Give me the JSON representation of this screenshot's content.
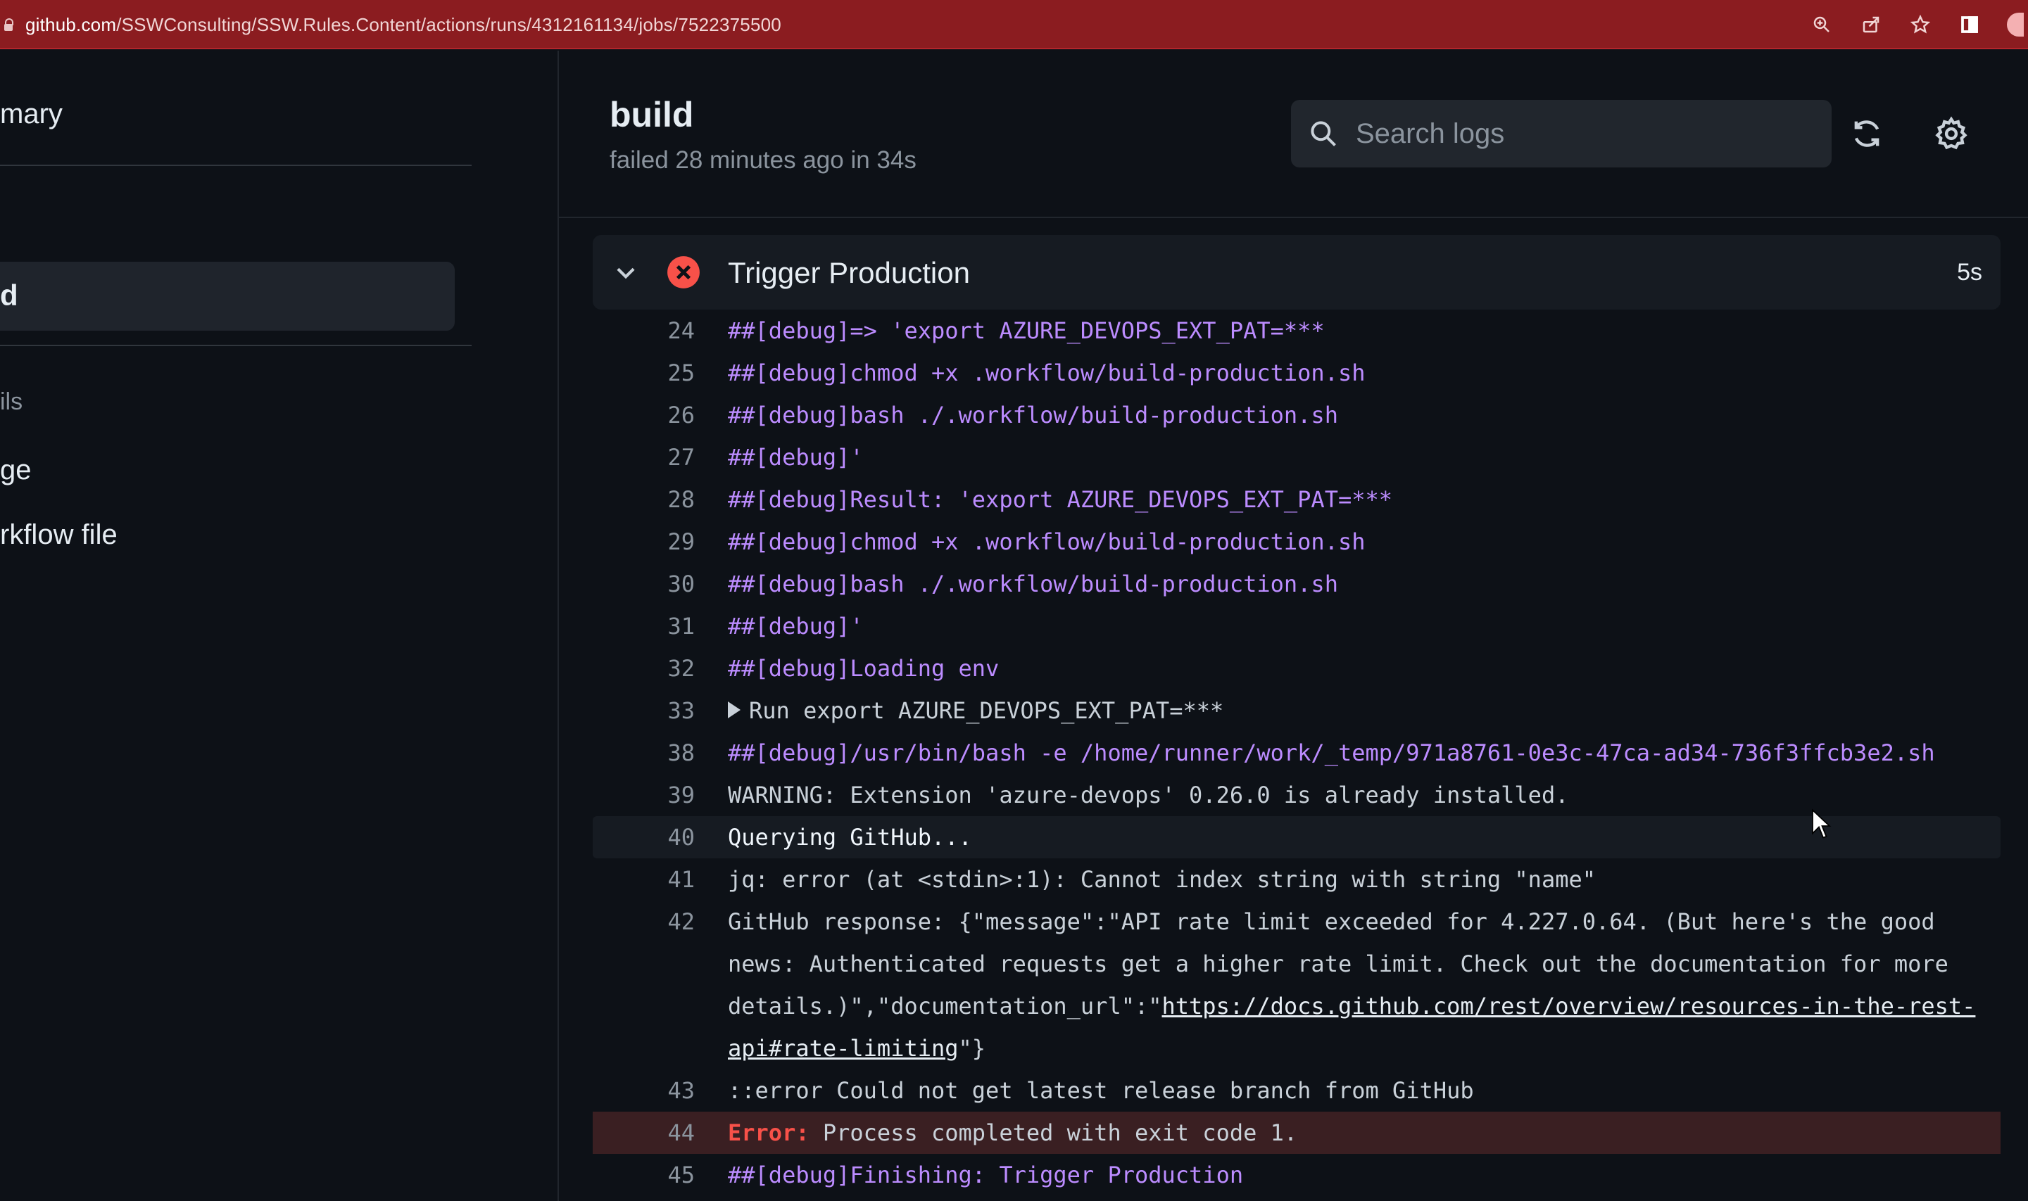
{
  "browser": {
    "url_host": "github.com",
    "url_path": "/SSWConsulting/SSW.Rules.Content/actions/runs/4312161134/jobs/7522375500"
  },
  "sidebar": {
    "summary": "mary",
    "build": "d",
    "details": "ils",
    "usage": "ge",
    "workflow_file": "rkflow file"
  },
  "job": {
    "title": "build",
    "status": "failed 28 minutes ago in 34s"
  },
  "search": {
    "placeholder": "Search logs"
  },
  "step": {
    "name": "Trigger Production",
    "duration": "5s"
  },
  "log": {
    "lines": [
      {
        "n": "24",
        "text": "##[debug]=> 'export AZURE_DEVOPS_EXT_PAT=***"
      },
      {
        "n": "25",
        "text": "##[debug]chmod +x .workflow/build-production.sh"
      },
      {
        "n": "26",
        "text": "##[debug]bash ./.workflow/build-production.sh"
      },
      {
        "n": "27",
        "text": "##[debug]'"
      },
      {
        "n": "28",
        "text": "##[debug]Result: 'export AZURE_DEVOPS_EXT_PAT=***"
      },
      {
        "n": "29",
        "text": "##[debug]chmod +x .workflow/build-production.sh"
      },
      {
        "n": "30",
        "text": "##[debug]bash ./.workflow/build-production.sh"
      },
      {
        "n": "31",
        "text": "##[debug]'"
      },
      {
        "n": "32",
        "text": "##[debug]Loading env"
      },
      {
        "n": "33",
        "text": "Run export AZURE_DEVOPS_EXT_PAT=***"
      },
      {
        "n": "38",
        "text": "##[debug]/usr/bin/bash -e /home/runner/work/_temp/971a8761-0e3c-47ca-ad34-736f3ffcb3e2.sh"
      },
      {
        "n": "39",
        "text": "WARNING: Extension 'azure-devops' 0.26.0 is already installed."
      },
      {
        "n": "40",
        "text": "Querying GitHub..."
      },
      {
        "n": "41",
        "text": "jq: error (at <stdin>:1): Cannot index string with string \"name\""
      },
      {
        "n": "42",
        "text_before": "GitHub response: {\"message\":\"API rate limit exceeded for 4.227.0.64. (But here's the good news: Authenticated requests get a higher rate limit. Check out the documentation for more details.)\",\"documentation_url\":\"",
        "link": "https://docs.github.com/rest/overview/resources-in-the-rest-api#rate-limiting",
        "text_after": "\"}"
      },
      {
        "n": "43",
        "text": "::error Could not get latest release branch from GitHub"
      },
      {
        "n": "44",
        "error_label": "Error:",
        "text": " Process completed with exit code 1."
      },
      {
        "n": "45",
        "text": "##[debug]Finishing: Trigger Production"
      }
    ]
  },
  "colors": {
    "debug": "#bc8cff",
    "error": "#f85149",
    "address_bar": "#8b1c20"
  }
}
